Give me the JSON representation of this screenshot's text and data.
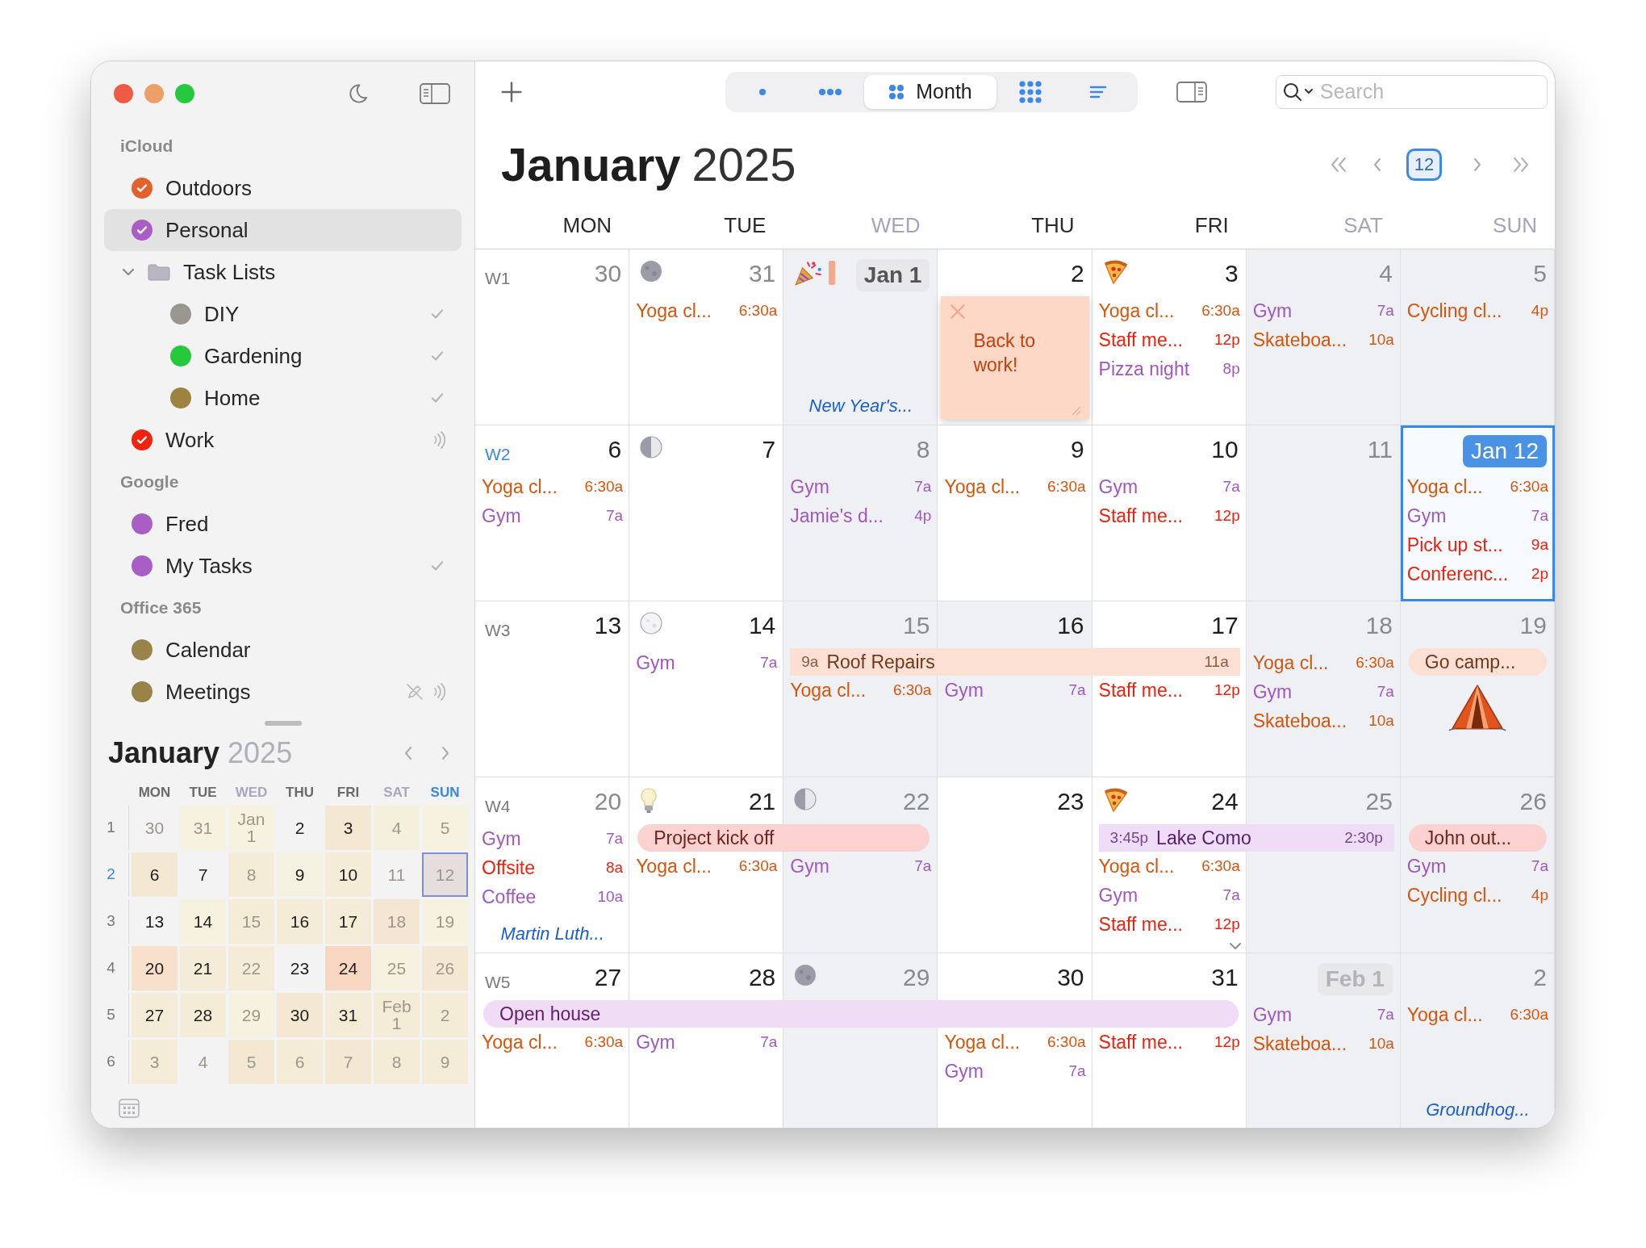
{
  "sidebar": {
    "groups": [
      {
        "title": "iCloud",
        "items": [
          {
            "kind": "calendar",
            "label": "Outdoors",
            "color": "#e2622e",
            "checked": true,
            "selected": false
          },
          {
            "kind": "calendar",
            "label": "Personal",
            "color": "#a95ec6",
            "checked": true,
            "selected": true
          },
          {
            "kind": "folder",
            "label": "Task Lists",
            "expanded": true,
            "selected": false,
            "children": [
              {
                "kind": "calendar",
                "label": "DIY",
                "color": "#9a9690",
                "checked": false,
                "selected": false,
                "accessories": [
                  {
                    "kind": "checkmark"
                  }
                ]
              },
              {
                "kind": "calendar",
                "label": "Gardening",
                "color": "#25c93b",
                "checked": false,
                "selected": false,
                "accessories": [
                  {
                    "kind": "checkmark"
                  }
                ]
              },
              {
                "kind": "calendar",
                "label": "Home",
                "color": "#9c8340",
                "checked": false,
                "selected": false,
                "accessories": [
                  {
                    "kind": "checkmark"
                  }
                ]
              }
            ]
          },
          {
            "kind": "calendar",
            "label": "Work",
            "color": "#f0230f",
            "checked": true,
            "selected": false,
            "accessories": [
              {
                "kind": "broadcast"
              }
            ]
          }
        ]
      },
      {
        "title": "Google",
        "items": [
          {
            "kind": "calendar",
            "label": "Fred",
            "color": "#a95ec6",
            "checked": false,
            "selected": false
          },
          {
            "kind": "calendar",
            "label": "My Tasks",
            "color": "#a95ec6",
            "checked": false,
            "selected": false,
            "accessories": [
              {
                "kind": "checkmark"
              }
            ]
          }
        ]
      },
      {
        "title": "Office 365",
        "items": [
          {
            "kind": "calendar",
            "label": "Calendar",
            "color": "#9a8348",
            "checked": false,
            "selected": false
          },
          {
            "kind": "calendar",
            "label": "Meetings",
            "color": "#9a8348",
            "checked": false,
            "selected": false,
            "accessories": [
              {
                "kind": "pencil-slash"
              },
              {
                "kind": "broadcast"
              }
            ]
          }
        ]
      }
    ]
  },
  "mini_calendar": {
    "month": "January",
    "year": "2025",
    "weekdays": [
      {
        "label": "MON",
        "dimmed": false,
        "highlighted": false
      },
      {
        "label": "TUE",
        "dimmed": false,
        "highlighted": false
      },
      {
        "label": "WED",
        "dimmed": true,
        "highlighted": false
      },
      {
        "label": "THU",
        "dimmed": false,
        "highlighted": false
      },
      {
        "label": "FRI",
        "dimmed": false,
        "highlighted": false
      },
      {
        "label": "SAT",
        "dimmed": true,
        "highlighted": false
      },
      {
        "label": "SUN",
        "dimmed": false,
        "highlighted": true
      }
    ],
    "weeks": [
      {
        "number": "1",
        "current": false,
        "days": [
          {
            "label": "30",
            "dimmed": true,
            "selected": false
          },
          {
            "label": "31",
            "dimmed": true,
            "selected": false,
            "color": "#f6f2df"
          },
          {
            "label": "Jan 1",
            "dimmed": true,
            "selected": false,
            "color": "#f6f2df"
          },
          {
            "label": "2",
            "dimmed": false,
            "selected": false
          },
          {
            "label": "3",
            "dimmed": false,
            "selected": false,
            "color": "#f5e8d3"
          },
          {
            "label": "4",
            "dimmed": true,
            "selected": false,
            "color": "#f5f0dc"
          },
          {
            "label": "5",
            "dimmed": true,
            "selected": false,
            "color": "#f6f2df"
          }
        ]
      },
      {
        "number": "2",
        "current": true,
        "days": [
          {
            "label": "6",
            "dimmed": false,
            "selected": false,
            "color": "#f5e8d3"
          },
          {
            "label": "7",
            "dimmed": false,
            "selected": false
          },
          {
            "label": "8",
            "dimmed": true,
            "selected": false,
            "color": "#f5ecd8"
          },
          {
            "label": "9",
            "dimmed": false,
            "selected": false,
            "color": "#f3f1df"
          },
          {
            "label": "10",
            "dimmed": false,
            "selected": false,
            "color": "#f5ecd8"
          },
          {
            "label": "11",
            "dimmed": true,
            "selected": false
          },
          {
            "label": "12",
            "dimmed": true,
            "selected": true,
            "color": "#e6dedc"
          }
        ]
      },
      {
        "number": "3",
        "current": false,
        "days": [
          {
            "label": "13",
            "dimmed": false,
            "selected": false
          },
          {
            "label": "14",
            "dimmed": false,
            "selected": false,
            "color": "#f6f2df"
          },
          {
            "label": "15",
            "dimmed": true,
            "selected": false,
            "color": "#f5ecd8"
          },
          {
            "label": "16",
            "dimmed": false,
            "selected": false,
            "color": "#f5ecd8"
          },
          {
            "label": "17",
            "dimmed": false,
            "selected": false,
            "color": "#f5ecd8"
          },
          {
            "label": "18",
            "dimmed": true,
            "selected": false,
            "color": "#f5e6d3"
          },
          {
            "label": "19",
            "dimmed": true,
            "selected": false,
            "color": "#f6f2df"
          }
        ]
      },
      {
        "number": "4",
        "current": false,
        "days": [
          {
            "label": "20",
            "dimmed": false,
            "selected": false,
            "color": "#f7e0cc"
          },
          {
            "label": "21",
            "dimmed": false,
            "selected": false,
            "color": "#f5ecd8"
          },
          {
            "label": "22",
            "dimmed": true,
            "selected": false,
            "color": "#f5ecd8"
          },
          {
            "label": "23",
            "dimmed": false,
            "selected": false
          },
          {
            "label": "24",
            "dimmed": false,
            "selected": false,
            "color": "#f8d6bf"
          },
          {
            "label": "25",
            "dimmed": true,
            "selected": false,
            "color": "#f6f2df"
          },
          {
            "label": "26",
            "dimmed": true,
            "selected": false,
            "color": "#f5e8d3"
          }
        ]
      },
      {
        "number": "5",
        "current": false,
        "days": [
          {
            "label": "27",
            "dimmed": false,
            "selected": false,
            "color": "#f5ecd8"
          },
          {
            "label": "28",
            "dimmed": false,
            "selected": false,
            "color": "#f5ecd8"
          },
          {
            "label": "29",
            "dimmed": true,
            "selected": false,
            "color": "#f6f2df"
          },
          {
            "label": "30",
            "dimmed": false,
            "selected": false,
            "color": "#f5e8d3"
          },
          {
            "label": "31",
            "dimmed": false,
            "selected": false,
            "color": "#f5ecd8"
          },
          {
            "label": "Feb 1",
            "dimmed": true,
            "selected": false,
            "color": "#f5ecd8"
          },
          {
            "label": "2",
            "dimmed": true,
            "selected": false,
            "color": "#f5ecd8"
          }
        ]
      },
      {
        "number": "6",
        "current": false,
        "days": [
          {
            "label": "3",
            "dimmed": true,
            "selected": false,
            "color": "#f5ecd8"
          },
          {
            "label": "4",
            "dimmed": true,
            "selected": false
          },
          {
            "label": "5",
            "dimmed": true,
            "selected": false,
            "color": "#f5e8d3"
          },
          {
            "label": "6",
            "dimmed": true,
            "selected": false,
            "color": "#f5ecd8"
          },
          {
            "label": "7",
            "dimmed": true,
            "selected": false,
            "color": "#f5e8d3"
          },
          {
            "label": "8",
            "dimmed": true,
            "selected": false,
            "color": "#f5ecd8"
          },
          {
            "label": "9",
            "dimmed": true,
            "selected": false,
            "color": "#f5ecd8"
          }
        ]
      }
    ]
  },
  "toolbar": {
    "views": [
      {
        "kind": "day",
        "selected": false
      },
      {
        "kind": "week",
        "selected": false
      },
      {
        "kind": "month",
        "label": "Month",
        "selected": true
      },
      {
        "kind": "year",
        "selected": false
      },
      {
        "kind": "list",
        "selected": false
      }
    ],
    "search": {
      "placeholder": "Search"
    }
  },
  "calendar": {
    "month": "January",
    "year": "2025",
    "today_label": "12",
    "weekdays": [
      {
        "label": "MON",
        "dimmed": false
      },
      {
        "label": "TUE",
        "dimmed": false
      },
      {
        "label": "WED",
        "dimmed": true
      },
      {
        "label": "THU",
        "dimmed": false
      },
      {
        "label": "FRI",
        "dimmed": false
      },
      {
        "label": "SAT",
        "dimmed": true
      },
      {
        "label": "SUN",
        "dimmed": true
      }
    ],
    "weeks": [
      {
        "label": "W1",
        "current": false,
        "days": [
          {
            "label": "30",
            "kind": "plain",
            "dimmed": true,
            "shaded": false,
            "selected": false,
            "more": false
          },
          {
            "label": "31",
            "kind": "plain",
            "dimmed": true,
            "shaded": false,
            "selected": false,
            "more": false,
            "decorations": [
              {
                "kind": "new-moon"
              }
            ],
            "events": [
              {
                "title": "Yoga cl...",
                "time": "6:30a",
                "color": "#d9540c"
              }
            ]
          },
          {
            "label": "Jan 1",
            "kind": "month-start",
            "dimmed": false,
            "shaded": true,
            "selected": false,
            "more": false,
            "decorations": [
              {
                "kind": "party"
              },
              {
                "kind": "tag"
              }
            ],
            "holiday": "New Year's..."
          },
          {
            "label": "2",
            "kind": "plain",
            "dimmed": false,
            "shaded": false,
            "selected": false,
            "more": false,
            "note": "Back to work!"
          },
          {
            "label": "3",
            "kind": "plain",
            "dimmed": false,
            "shaded": false,
            "selected": false,
            "more": false,
            "decorations": [
              {
                "kind": "pizza"
              }
            ],
            "events": [
              {
                "title": "Yoga cl...",
                "time": "6:30a",
                "color": "#d9540c"
              },
              {
                "title": "Staff me...",
                "time": "12p",
                "color": "#f0200c"
              },
              {
                "title": "Pizza night",
                "time": "8p",
                "color": "#a157c0"
              }
            ]
          },
          {
            "label": "4",
            "kind": "plain",
            "dimmed": true,
            "shaded": true,
            "selected": false,
            "more": false,
            "events": [
              {
                "title": "Gym",
                "time": "7a",
                "color": "#a157c0"
              },
              {
                "title": "Skateboa...",
                "time": "10a",
                "color": "#d9540c"
              }
            ]
          },
          {
            "label": "5",
            "kind": "plain",
            "dimmed": true,
            "shaded": true,
            "selected": false,
            "more": false,
            "events": [
              {
                "title": "Cycling cl...",
                "time": "4p",
                "color": "#d9540c"
              }
            ]
          }
        ]
      },
      {
        "label": "W2",
        "current": true,
        "days": [
          {
            "label": "6",
            "kind": "plain",
            "dimmed": false,
            "shaded": false,
            "selected": false,
            "more": false,
            "events": [
              {
                "title": "Yoga cl...",
                "time": "6:30a",
                "color": "#d9540c"
              },
              {
                "title": "Gym",
                "time": "7a",
                "color": "#a157c0"
              }
            ]
          },
          {
            "label": "7",
            "kind": "plain",
            "dimmed": false,
            "shaded": false,
            "selected": false,
            "more": false,
            "decorations": [
              {
                "kind": "half-moon"
              }
            ]
          },
          {
            "label": "8",
            "kind": "plain",
            "dimmed": true,
            "shaded": true,
            "selected": false,
            "more": false,
            "events": [
              {
                "title": "Gym",
                "time": "7a",
                "color": "#a157c0"
              },
              {
                "title": "Jamie's d...",
                "time": "4p",
                "color": "#a157c0"
              }
            ]
          },
          {
            "label": "9",
            "kind": "plain",
            "dimmed": false,
            "shaded": false,
            "selected": false,
            "more": false,
            "events": [
              {
                "title": "Yoga cl...",
                "time": "6:30a",
                "color": "#d9540c"
              }
            ]
          },
          {
            "label": "10",
            "kind": "plain",
            "dimmed": false,
            "shaded": false,
            "selected": false,
            "more": false,
            "events": [
              {
                "title": "Gym",
                "time": "7a",
                "color": "#a157c0"
              },
              {
                "title": "Staff me...",
                "time": "12p",
                "color": "#f0200c"
              }
            ]
          },
          {
            "label": "11",
            "kind": "plain",
            "dimmed": true,
            "shaded": true,
            "selected": false,
            "more": false
          },
          {
            "label": "Jan 12",
            "kind": "today",
            "dimmed": false,
            "shaded": false,
            "selected": true,
            "more": false,
            "events": [
              {
                "title": "Yoga cl...",
                "time": "6:30a",
                "color": "#d9540c"
              },
              {
                "title": "Gym",
                "time": "7a",
                "color": "#a157c0"
              },
              {
                "title": "Pick up st...",
                "time": "9a",
                "color": "#f0200c"
              },
              {
                "title": "Conferenc...",
                "time": "2p",
                "color": "#f0200c"
              }
            ]
          }
        ]
      },
      {
        "label": "W3",
        "current": false,
        "days": [
          {
            "label": "13",
            "kind": "plain",
            "dimmed": false,
            "shaded": false,
            "selected": false,
            "more": false
          },
          {
            "label": "14",
            "kind": "plain",
            "dimmed": false,
            "shaded": false,
            "selected": false,
            "more": false,
            "decorations": [
              {
                "kind": "full-moon"
              }
            ],
            "events": [
              {
                "title": "Gym",
                "time": "7a",
                "color": "#a157c0"
              }
            ]
          },
          {
            "label": "15",
            "kind": "plain",
            "dimmed": true,
            "shaded": true,
            "selected": false,
            "more": false,
            "bar": {
              "kind": "block",
              "title": "Roof Repairs",
              "start": "9a",
              "end": "11a",
              "color": "#fde0d4"
            },
            "events": [
              {
                "title": "Yoga cl...",
                "time": "6:30a",
                "color": "#d9540c"
              }
            ]
          },
          {
            "label": "16",
            "kind": "plain",
            "dimmed": false,
            "shaded": true,
            "selected": false,
            "more": false,
            "bar": {
              "kind": "continued"
            },
            "events": [
              {
                "title": "Gym",
                "time": "7a",
                "color": "#a157c0"
              }
            ]
          },
          {
            "label": "17",
            "kind": "plain",
            "dimmed": false,
            "shaded": false,
            "selected": false,
            "more": false,
            "bar": {
              "kind": "continued"
            },
            "events": [
              {
                "title": "Staff me...",
                "time": "12p",
                "color": "#f0200c"
              }
            ]
          },
          {
            "label": "18",
            "kind": "plain",
            "dimmed": true,
            "shaded": true,
            "selected": false,
            "more": false,
            "events": [
              {
                "title": "Yoga cl...",
                "time": "6:30a",
                "color": "#d9540c"
              },
              {
                "title": "Gym",
                "time": "7a",
                "color": "#a157c0"
              },
              {
                "title": "Skateboa...",
                "time": "10a",
                "color": "#d9540c"
              }
            ]
          },
          {
            "label": "19",
            "kind": "plain",
            "dimmed": true,
            "shaded": true,
            "selected": false,
            "more": false,
            "bar": {
              "kind": "pill",
              "title": "Go camp...",
              "color": "#fde0d4"
            },
            "pictures": [
              {
                "kind": "tent"
              }
            ]
          }
        ]
      },
      {
        "label": "W4",
        "current": false,
        "days": [
          {
            "label": "20",
            "kind": "plain",
            "dimmed": true,
            "shaded": false,
            "selected": false,
            "more": false,
            "events": [
              {
                "title": "Gym",
                "time": "7a",
                "color": "#a157c0"
              },
              {
                "title": "Offsite",
                "time": "8a",
                "color": "#f0200c"
              },
              {
                "title": "Coffee",
                "time": "10a",
                "color": "#a157c0"
              }
            ],
            "holiday": "Martin Luth..."
          },
          {
            "label": "21",
            "kind": "plain",
            "dimmed": false,
            "shaded": false,
            "selected": false,
            "more": false,
            "decorations": [
              {
                "kind": "bulb"
              }
            ],
            "bar": {
              "kind": "pill",
              "title": "Project kick off",
              "color": "#fcd2d0"
            },
            "events": [
              {
                "title": "Yoga cl...",
                "time": "6:30a",
                "color": "#d9540c"
              }
            ]
          },
          {
            "label": "22",
            "kind": "plain",
            "dimmed": true,
            "shaded": true,
            "selected": false,
            "more": false,
            "decorations": [
              {
                "kind": "half-moon"
              }
            ],
            "bar": {
              "kind": "continued"
            },
            "events": [
              {
                "title": "Gym",
                "time": "7a",
                "color": "#a157c0"
              }
            ]
          },
          {
            "label": "23",
            "kind": "plain",
            "dimmed": false,
            "shaded": false,
            "selected": false,
            "more": false
          },
          {
            "label": "24",
            "kind": "plain",
            "dimmed": false,
            "shaded": false,
            "selected": false,
            "more": true,
            "decorations": [
              {
                "kind": "pizza"
              }
            ],
            "bar": {
              "kind": "block",
              "title": "Lake Como",
              "start": "3:45p",
              "end": "2:30p",
              "color": "#efdcf7"
            },
            "events": [
              {
                "title": "Yoga cl...",
                "time": "6:30a",
                "color": "#d9540c"
              },
              {
                "title": "Gym",
                "time": "7a",
                "color": "#a157c0"
              },
              {
                "title": "Staff me...",
                "time": "12p",
                "color": "#f0200c"
              }
            ]
          },
          {
            "label": "25",
            "kind": "plain",
            "dimmed": true,
            "shaded": true,
            "selected": false,
            "more": false,
            "bar": {
              "kind": "continued"
            }
          },
          {
            "label": "26",
            "kind": "plain",
            "dimmed": true,
            "shaded": true,
            "selected": false,
            "more": false,
            "bar": {
              "kind": "pill",
              "title": "John out...",
              "color": "#fcd2d0"
            },
            "events": [
              {
                "title": "Gym",
                "time": "7a",
                "color": "#a157c0"
              },
              {
                "title": "Cycling cl...",
                "time": "4p",
                "color": "#d9540c"
              }
            ]
          }
        ]
      },
      {
        "label": "W5",
        "current": false,
        "days": [
          {
            "label": "27",
            "kind": "plain",
            "dimmed": false,
            "shaded": false,
            "selected": false,
            "more": false,
            "bar": {
              "kind": "pill",
              "title": "Open house",
              "color": "#f0dcf5"
            },
            "events": [
              {
                "title": "Yoga cl...",
                "time": "6:30a",
                "color": "#d9540c"
              }
            ]
          },
          {
            "label": "28",
            "kind": "plain",
            "dimmed": false,
            "shaded": false,
            "selected": false,
            "more": false,
            "bar": {
              "kind": "continued"
            },
            "events": [
              {
                "title": "Gym",
                "time": "7a",
                "color": "#a157c0"
              }
            ]
          },
          {
            "label": "29",
            "kind": "plain",
            "dimmed": true,
            "shaded": true,
            "selected": false,
            "more": false,
            "decorations": [
              {
                "kind": "new-moon"
              }
            ],
            "bar": {
              "kind": "continued"
            }
          },
          {
            "label": "30",
            "kind": "plain",
            "dimmed": false,
            "shaded": false,
            "selected": false,
            "more": false,
            "bar": {
              "kind": "continued"
            },
            "events": [
              {
                "title": "Yoga cl...",
                "time": "6:30a",
                "color": "#d9540c"
              },
              {
                "title": "Gym",
                "time": "7a",
                "color": "#a157c0"
              }
            ]
          },
          {
            "label": "31",
            "kind": "plain",
            "dimmed": false,
            "shaded": false,
            "selected": false,
            "more": false,
            "bar": {
              "kind": "continued"
            },
            "events": [
              {
                "title": "Staff me...",
                "time": "12p",
                "color": "#f0200c"
              }
            ]
          },
          {
            "label": "Feb 1",
            "kind": "month-start",
            "dimmed": true,
            "shaded": true,
            "selected": false,
            "more": false,
            "events": [
              {
                "title": "Gym",
                "time": "7a",
                "color": "#a157c0"
              },
              {
                "title": "Skateboa...",
                "time": "10a",
                "color": "#d9540c"
              }
            ]
          },
          {
            "label": "2",
            "kind": "plain",
            "dimmed": true,
            "shaded": true,
            "selected": false,
            "more": false,
            "events": [
              {
                "title": "Yoga cl...",
                "time": "6:30a",
                "color": "#d9540c"
              }
            ],
            "holiday": "Groundhog..."
          }
        ]
      }
    ]
  }
}
